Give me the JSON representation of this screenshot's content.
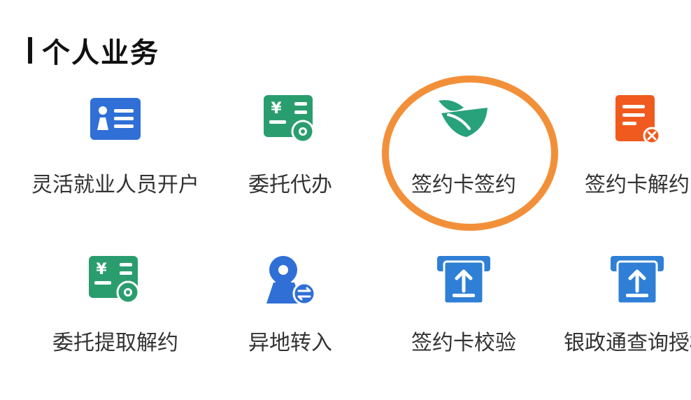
{
  "section": {
    "title": "个人业务"
  },
  "services": [
    {
      "label": "灵活就业人员开户",
      "icon": "id-card-icon",
      "color": "#2f6fd6"
    },
    {
      "label": "委托代办",
      "icon": "entrust-settings-icon",
      "color": "#2a9d6e"
    },
    {
      "label": "签约卡签约",
      "icon": "sign-card-leaf-icon",
      "color": "#27a27a"
    },
    {
      "label": "签约卡解约",
      "icon": "cancel-document-icon",
      "color": "#f05a1e"
    },
    {
      "label": "委托提取解约",
      "icon": "entrust-settings-icon",
      "color": "#2a9d6e"
    },
    {
      "label": "异地转入",
      "icon": "location-transfer-icon",
      "color": "#2f6fd6"
    },
    {
      "label": "签约卡校验",
      "icon": "upload-card-icon",
      "color": "#2f7fd6"
    },
    {
      "label": "银政通查询授权",
      "icon": "upload-card-icon",
      "color": "#2f7fd6"
    }
  ]
}
